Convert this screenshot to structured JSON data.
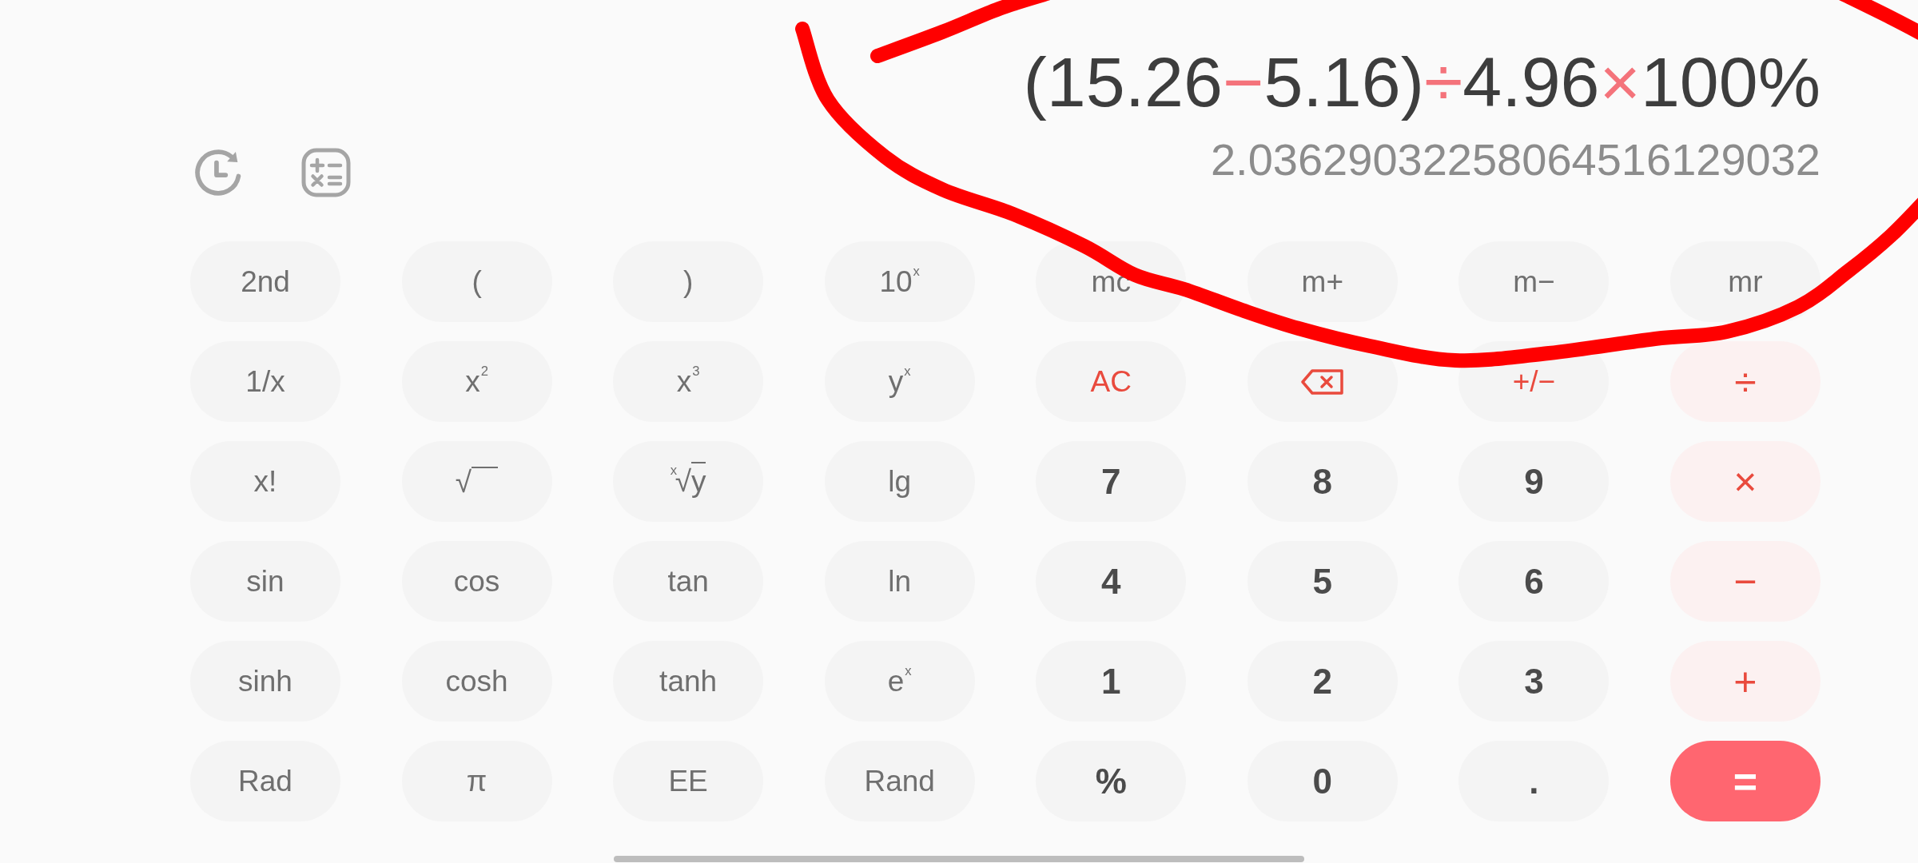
{
  "display": {
    "expression": [
      {
        "text": "(15.26",
        "kind": "operand"
      },
      {
        "text": "−",
        "kind": "operator"
      },
      {
        "text": "5.16)",
        "kind": "operand"
      },
      {
        "text": "÷",
        "kind": "operator"
      },
      {
        "text": "4.96",
        "kind": "operand"
      },
      {
        "text": "×",
        "kind": "operator"
      },
      {
        "text": "100%",
        "kind": "operand"
      }
    ],
    "result": "2.03629032258064516129032"
  },
  "keypad": {
    "rows": [
      [
        {
          "label": "2nd",
          "kind": "function"
        },
        {
          "label": "(",
          "kind": "function"
        },
        {
          "label": ")",
          "kind": "function"
        },
        {
          "label": "10$^{x}$",
          "kind": "function"
        },
        {
          "label": "mc",
          "kind": "function"
        },
        {
          "label": "m+",
          "kind": "function"
        },
        {
          "label": "m−",
          "kind": "function"
        },
        {
          "label": "mr",
          "kind": "function"
        }
      ],
      [
        {
          "label": "1/x",
          "kind": "function"
        },
        {
          "label": "x$^{2}$",
          "kind": "function"
        },
        {
          "label": "x$^{3}$",
          "kind": "function"
        },
        {
          "label": "y$^{x}$",
          "kind": "function"
        },
        {
          "label": "AC",
          "kind": "control"
        },
        {
          "kind": "backspace"
        },
        {
          "label": "+/−",
          "kind": "control"
        },
        {
          "label": "÷",
          "kind": "operator"
        }
      ],
      [
        {
          "label": "x!",
          "kind": "function"
        },
        {
          "kind": "root",
          "radical": "√"
        },
        {
          "kind": "root",
          "index": "x",
          "radical": "√",
          "radicand": "y"
        },
        {
          "label": "lg",
          "kind": "function"
        },
        {
          "label": "7",
          "kind": "digit"
        },
        {
          "label": "8",
          "kind": "digit"
        },
        {
          "label": "9",
          "kind": "digit"
        },
        {
          "label": "×",
          "kind": "operator"
        }
      ],
      [
        {
          "label": "sin",
          "kind": "function"
        },
        {
          "label": "cos",
          "kind": "function"
        },
        {
          "label": "tan",
          "kind": "function"
        },
        {
          "label": "ln",
          "kind": "function"
        },
        {
          "label": "4",
          "kind": "digit"
        },
        {
          "label": "5",
          "kind": "digit"
        },
        {
          "label": "6",
          "kind": "digit"
        },
        {
          "label": "−",
          "kind": "operator"
        }
      ],
      [
        {
          "label": "sinh",
          "kind": "function"
        },
        {
          "label": "cosh",
          "kind": "function"
        },
        {
          "label": "tanh",
          "kind": "function"
        },
        {
          "label": "e$^{x}$",
          "kind": "function"
        },
        {
          "label": "1",
          "kind": "digit"
        },
        {
          "label": "2",
          "kind": "digit"
        },
        {
          "label": "3",
          "kind": "digit"
        },
        {
          "label": "+",
          "kind": "operator"
        }
      ],
      [
        {
          "label": "Rad",
          "kind": "function"
        },
        {
          "label": "π",
          "kind": "function"
        },
        {
          "label": "EE",
          "kind": "function"
        },
        {
          "label": "Rand",
          "kind": "function"
        },
        {
          "label": "%",
          "kind": "digit"
        },
        {
          "label": "0",
          "kind": "digit"
        },
        {
          "label": ".",
          "kind": "digit"
        },
        {
          "label": "=",
          "kind": "equals"
        }
      ]
    ]
  }
}
